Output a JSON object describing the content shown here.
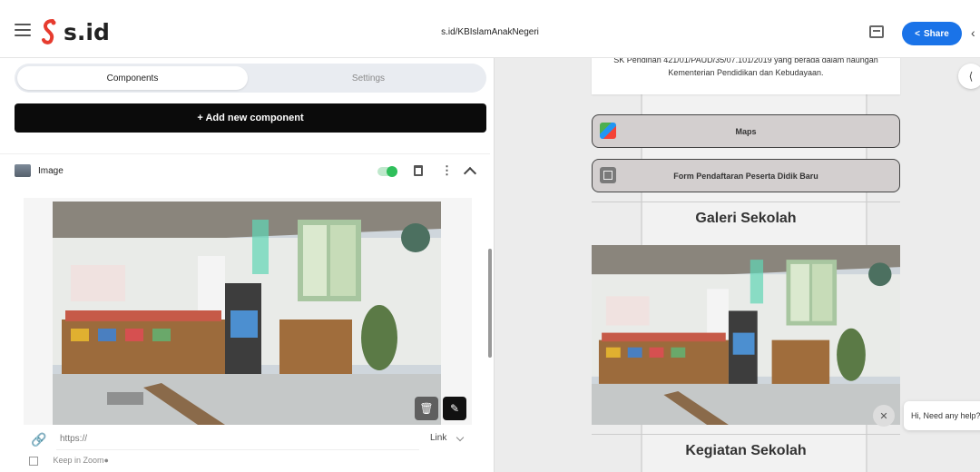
{
  "topbar": {
    "logo_text": "s.id",
    "url": "s.id/KBIslamAnakNegeri",
    "share_label": "Share"
  },
  "editor": {
    "tabs": [
      "Components",
      "Settings"
    ],
    "active_tab": "Components",
    "add_button_label": "+ Add new component",
    "component": {
      "label": "Image",
      "enabled": true
    },
    "link": {
      "placeholder": "https://",
      "type_label": "Link"
    },
    "zoom_label": "Keep in Zoom●"
  },
  "preview": {
    "description": "SK Pendirian 421/01/PAUD/35/07.101/2019 yang berada dalam naungan Kementerian Pendidikan dan Kebudayaan.",
    "buttons": [
      {
        "label": "Maps",
        "icon": "maps-icon"
      },
      {
        "label": "Form Pendaftaran Peserta Didik Baru",
        "icon": "form-icon"
      }
    ],
    "gallery_heading": "Galeri Sekolah",
    "activities_heading": "Kegiatan Sekolah",
    "chat_text": "Hi, Need any help?"
  },
  "colors": {
    "accent": "#1a73e8",
    "toggle_on": "#2fbf5b",
    "dark_button": "#0b0b0b"
  }
}
